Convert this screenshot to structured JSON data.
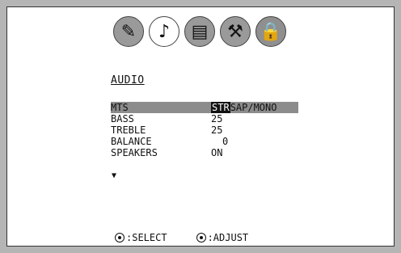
{
  "window": {
    "title": "AUDIO"
  },
  "icons": [
    {
      "name": "picture-icon",
      "glyph": "✎"
    },
    {
      "name": "audio-icon",
      "glyph": "♪"
    },
    {
      "name": "features-icon",
      "glyph": "▤"
    },
    {
      "name": "tools-icon",
      "glyph": "⚒"
    },
    {
      "name": "lock-icon",
      "glyph": "🔒"
    }
  ],
  "menu": {
    "mts_label": "MTS",
    "mts_selected": "STR",
    "mts_options": "SAP/MONO",
    "bass_label": "BASS",
    "bass_value": "25",
    "treble_label": "TREBLE",
    "treble_value": "25",
    "balance_label": "BALANCE",
    "balance_value": "0",
    "speakers_label": "SPEAKERS",
    "speakers_value": "ON",
    "more_indicator": "▼"
  },
  "footer": {
    "select_label": ":SELECT",
    "adjust_label": ":ADJUST"
  },
  "colors": {
    "border": "#b5b5b5",
    "highlight_row": "#8c8c8c",
    "selected_value_bg": "#111111",
    "text": "#111111"
  }
}
